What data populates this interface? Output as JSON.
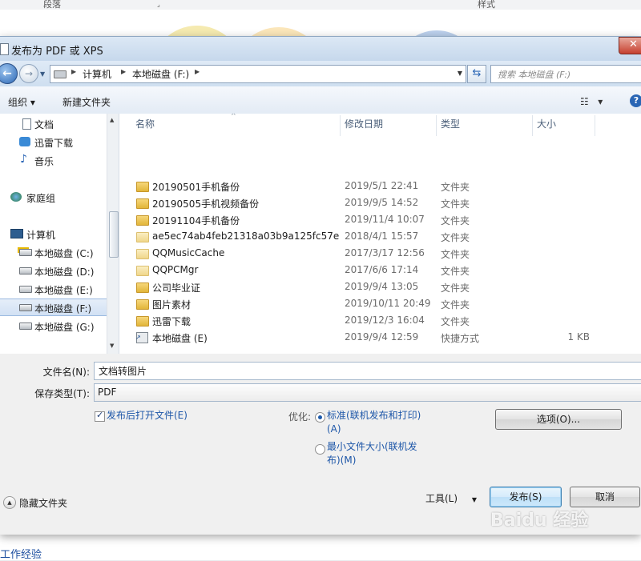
{
  "background": {
    "ribbon_labels": [
      "段落",
      "样式"
    ],
    "doc_bottom_text": "工作经验"
  },
  "dialog": {
    "title": "发布为 PDF 或 XPS"
  },
  "navbar": {
    "breadcrumbs": [
      "计算机",
      "本地磁盘 (F:)"
    ],
    "search_placeholder": "搜索 本地磁盘 (F:)"
  },
  "toolbar": {
    "organize": "组织 ▾",
    "new_folder": "新建文件夹"
  },
  "nav_pane": {
    "items": [
      {
        "label": "文档",
        "icon": "document-icon"
      },
      {
        "label": "迅雷下载",
        "icon": "download-icon"
      },
      {
        "label": "音乐",
        "icon": "music-icon"
      },
      {
        "label": "家庭组",
        "icon": "homegroup-icon"
      },
      {
        "label": "计算机",
        "icon": "computer-icon"
      },
      {
        "label": "本地磁盘 (C:)",
        "icon": "drive-icon"
      },
      {
        "label": "本地磁盘 (D:)",
        "icon": "drive-icon"
      },
      {
        "label": "本地磁盘 (E:)",
        "icon": "drive-icon"
      },
      {
        "label": "本地磁盘 (F:)",
        "icon": "drive-icon",
        "selected": true
      },
      {
        "label": "本地磁盘 (G:)",
        "icon": "drive-icon"
      }
    ]
  },
  "file_list": {
    "columns": [
      "名称",
      "修改日期",
      "类型",
      "大小"
    ],
    "rows": [
      {
        "name": "20190501手机备份",
        "date": "2019/5/1 22:41",
        "type": "文件夹",
        "size": ""
      },
      {
        "name": "20190505手机视频备份",
        "date": "2019/9/5 14:52",
        "type": "文件夹",
        "size": ""
      },
      {
        "name": "20191104手机备份",
        "date": "2019/11/4 10:07",
        "type": "文件夹",
        "size": ""
      },
      {
        "name": "ae5ec74ab4feb21318a03b9a125fc57e",
        "date": "2018/4/1 15:57",
        "type": "文件夹",
        "size": ""
      },
      {
        "name": "QQMusicCache",
        "date": "2017/3/17 12:56",
        "type": "文件夹",
        "size": ""
      },
      {
        "name": "QQPCMgr",
        "date": "2017/6/6 17:14",
        "type": "文件夹",
        "size": ""
      },
      {
        "name": "公司毕业证",
        "date": "2019/9/4 13:05",
        "type": "文件夹",
        "size": ""
      },
      {
        "name": "图片素材",
        "date": "2019/10/11 20:49",
        "type": "文件夹",
        "size": ""
      },
      {
        "name": "迅雷下载",
        "date": "2019/12/3 16:04",
        "type": "文件夹",
        "size": ""
      },
      {
        "name": "本地磁盘 (E)",
        "date": "2019/9/4 12:59",
        "type": "快捷方式",
        "size": "1 KB"
      }
    ]
  },
  "form": {
    "filename_label": "文件名(N):",
    "filename_value": "文档转图片",
    "savetype_label": "保存类型(T):",
    "savetype_value": "PDF",
    "open_after_publish": "发布后打开文件(E)",
    "optimize_label": "优化:",
    "option_standard_line1": "标准(联机发布和打印)",
    "option_standard_line2": "(A)",
    "option_minimum_line1": "最小文件大小(联机发",
    "option_minimum_line2": "布)(M)",
    "options_button": "选项(O)..."
  },
  "footer": {
    "hide_folders": "隐藏文件夹",
    "tools": "工具(L)",
    "publish": "发布(S)",
    "cancel": "取消"
  },
  "watermark": "Baidu 经验"
}
